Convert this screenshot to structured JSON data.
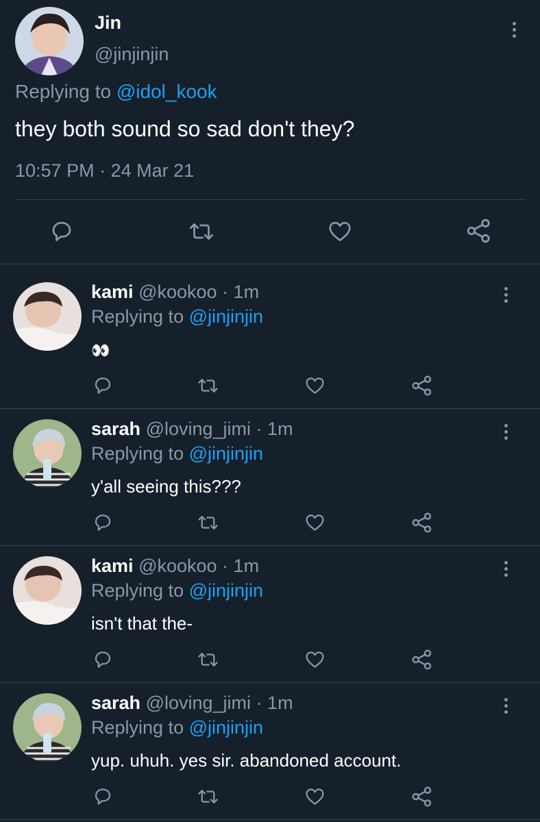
{
  "main_tweet": {
    "display_name": "Jin",
    "handle": "@jinjinjin",
    "replying_label": "Replying to",
    "replying_to": "@idol_kook",
    "text": "they both sound so sad don't they?",
    "timestamp": "10:57 PM · 24 Mar 21"
  },
  "replies": [
    {
      "display_name": "kami",
      "handle": "@kookoo",
      "time": "· 1m",
      "replying_label": "Replying to",
      "replying_to": "@jinjinjin",
      "text": "👀"
    },
    {
      "display_name": "sarah",
      "handle": "@loving_jimi",
      "time": "· 1m",
      "replying_label": "Replying to",
      "replying_to": "@jinjinjin",
      "text": "y'all seeing this???"
    },
    {
      "display_name": "kami",
      "handle": "@kookoo",
      "time": "· 1m",
      "replying_label": "Replying to",
      "replying_to": "@jinjinjin",
      "text": "isn't that the-"
    },
    {
      "display_name": "sarah",
      "handle": "@loving_jimi",
      "time": "· 1m",
      "replying_label": "Replying to",
      "replying_to": "@jinjinjin",
      "text": "yup. uhuh. yes sir. abandoned account."
    }
  ],
  "icons": {
    "reply": "reply-icon",
    "retweet": "retweet-icon",
    "like": "heart-icon",
    "share": "share-icon",
    "more": "more-vertical-icon"
  },
  "colors": {
    "background": "#15202b",
    "accent": "#1da1f2",
    "muted": "#8899a6",
    "divider": "#38444d"
  }
}
